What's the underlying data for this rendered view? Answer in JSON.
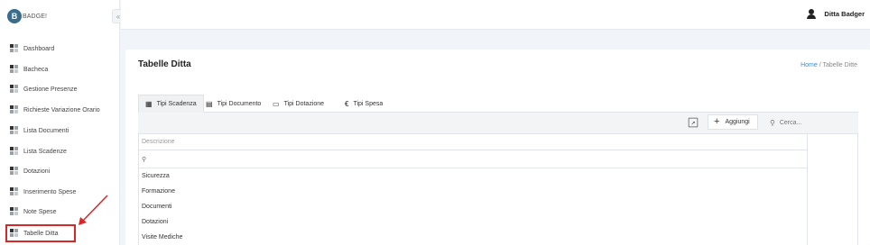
{
  "app": {
    "logo_text": "BADGE!",
    "logo_mark": "B"
  },
  "user": {
    "name": "Ditta Badger"
  },
  "sidebar": {
    "collapse_glyph": "«",
    "items": [
      {
        "label": "Dashboard"
      },
      {
        "label": "Bacheca"
      },
      {
        "label": "Gestione Presenze"
      },
      {
        "label": "Richieste Variazione Orario"
      },
      {
        "label": "Lista Documenti"
      },
      {
        "label": "Lista Scadenze"
      },
      {
        "label": "Dotazioni"
      },
      {
        "label": "Inserimento Spese"
      },
      {
        "label": "Note Spese"
      },
      {
        "label": "Tabelle Ditta"
      }
    ],
    "highlight_color": "#d62828"
  },
  "page": {
    "title": "Tabelle Ditta",
    "breadcrumb": {
      "home": "Home",
      "separator": " / ",
      "current": "Tabelle Ditte"
    }
  },
  "tabs": [
    {
      "label": "Tipi Scadenza",
      "icon": "calendar-icon",
      "glyph": "▦",
      "active": true
    },
    {
      "label": "Tipi Documento",
      "icon": "document-icon",
      "glyph": "▤",
      "active": false
    },
    {
      "label": "Tipi Dotazione",
      "icon": "laptop-icon",
      "glyph": "▭",
      "active": false
    },
    {
      "label": "Tipi Spesa",
      "icon": "euro-icon",
      "glyph": "€",
      "active": false
    }
  ],
  "toolbar": {
    "export_icon": "export-icon",
    "add_label": "Aggiungi",
    "search_placeholder": "Cerca..."
  },
  "table": {
    "column_header": "Descrizione",
    "rows": [
      {
        "description": "Sicurezza"
      },
      {
        "description": "Formazione"
      },
      {
        "description": "Documenti"
      },
      {
        "description": "Dotazioni"
      },
      {
        "description": "Visite Mediche"
      }
    ]
  },
  "colors": {
    "accent": "#3a8fd1",
    "highlight": "#d62828",
    "logo": "#3a6d8c"
  }
}
